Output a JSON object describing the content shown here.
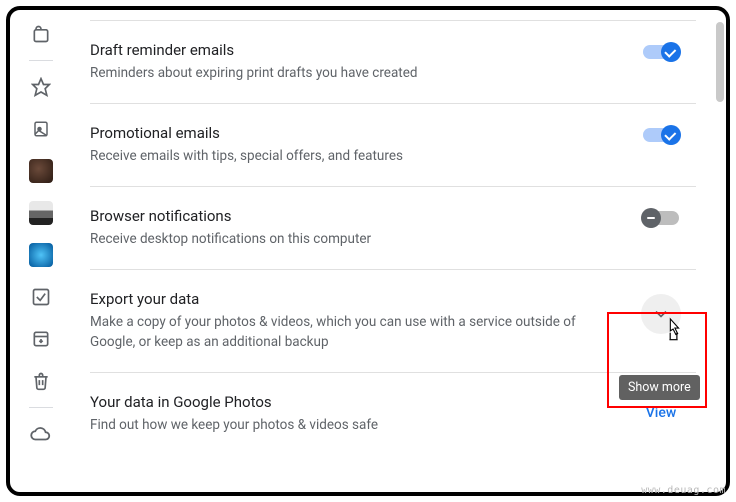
{
  "settings": [
    {
      "title": "Draft reminder emails",
      "desc": "Reminders about expiring print drafts you have created",
      "toggle": "on"
    },
    {
      "title": "Promotional emails",
      "desc": "Receive emails with tips, special offers, and features",
      "toggle": "on"
    },
    {
      "title": "Browser notifications",
      "desc": "Receive desktop notifications on this computer",
      "toggle": "off"
    },
    {
      "title": "Export your data",
      "desc": "Make a copy of your photos & videos, which you can use with a service outside of Google, or keep as an additional backup",
      "action": "expand"
    },
    {
      "title": "Your data in Google Photos",
      "desc": "Find out how we keep your photos & videos safe",
      "action": "link",
      "link_label": "View"
    }
  ],
  "tooltip": "Show more",
  "watermark": "www.deuag.com"
}
